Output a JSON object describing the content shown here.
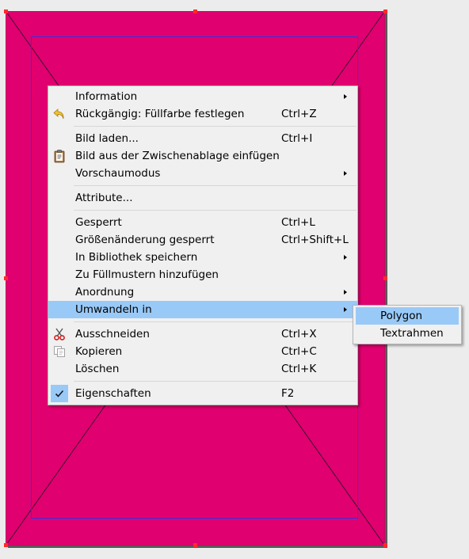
{
  "context_menu": {
    "items": [
      {
        "label": "Information",
        "shortcut": "",
        "submenu": true,
        "icon": ""
      },
      {
        "label": "Rückgängig: Füllfarbe festlegen",
        "shortcut": "Ctrl+Z",
        "submenu": false,
        "icon": "undo-icon"
      },
      {
        "label": "Bild laden...",
        "shortcut": "Ctrl+I",
        "submenu": false,
        "icon": ""
      },
      {
        "label": "Bild aus der Zwischenablage einfügen",
        "shortcut": "",
        "submenu": false,
        "icon": "clipboard-icon"
      },
      {
        "label": "Vorschaumodus",
        "shortcut": "",
        "submenu": true,
        "icon": ""
      },
      {
        "label": "Attribute...",
        "shortcut": "",
        "submenu": false,
        "icon": ""
      },
      {
        "label": "Gesperrt",
        "shortcut": "Ctrl+L",
        "submenu": false,
        "icon": ""
      },
      {
        "label": "Größenänderung gesperrt",
        "shortcut": "Ctrl+Shift+L",
        "submenu": false,
        "icon": ""
      },
      {
        "label": "In Bibliothek speichern",
        "shortcut": "",
        "submenu": true,
        "icon": ""
      },
      {
        "label": "Zu Füllmustern hinzufügen",
        "shortcut": "",
        "submenu": false,
        "icon": ""
      },
      {
        "label": "Anordnung",
        "shortcut": "",
        "submenu": true,
        "icon": ""
      },
      {
        "label": "Umwandeln in",
        "shortcut": "",
        "submenu": true,
        "icon": "",
        "highlighted": true
      },
      {
        "label": "Ausschneiden",
        "shortcut": "Ctrl+X",
        "submenu": false,
        "icon": "scissors-icon"
      },
      {
        "label": "Kopieren",
        "shortcut": "Ctrl+C",
        "submenu": false,
        "icon": "copy-icon"
      },
      {
        "label": "Löschen",
        "shortcut": "Ctrl+K",
        "submenu": false,
        "icon": ""
      },
      {
        "label": "Eigenschaften",
        "shortcut": "F2",
        "submenu": false,
        "icon": "checkmark-icon",
        "checked": true
      }
    ]
  },
  "convert_submenu": {
    "items": [
      {
        "label": "Polygon",
        "highlighted": true
      },
      {
        "label": "Textrahmen",
        "highlighted": false
      }
    ]
  },
  "colors": {
    "frame_fill": "#e0006f",
    "highlight": "#99c9f7",
    "menu_bg": "#f0f0f0",
    "guide_blue": "#3a2fe0"
  }
}
